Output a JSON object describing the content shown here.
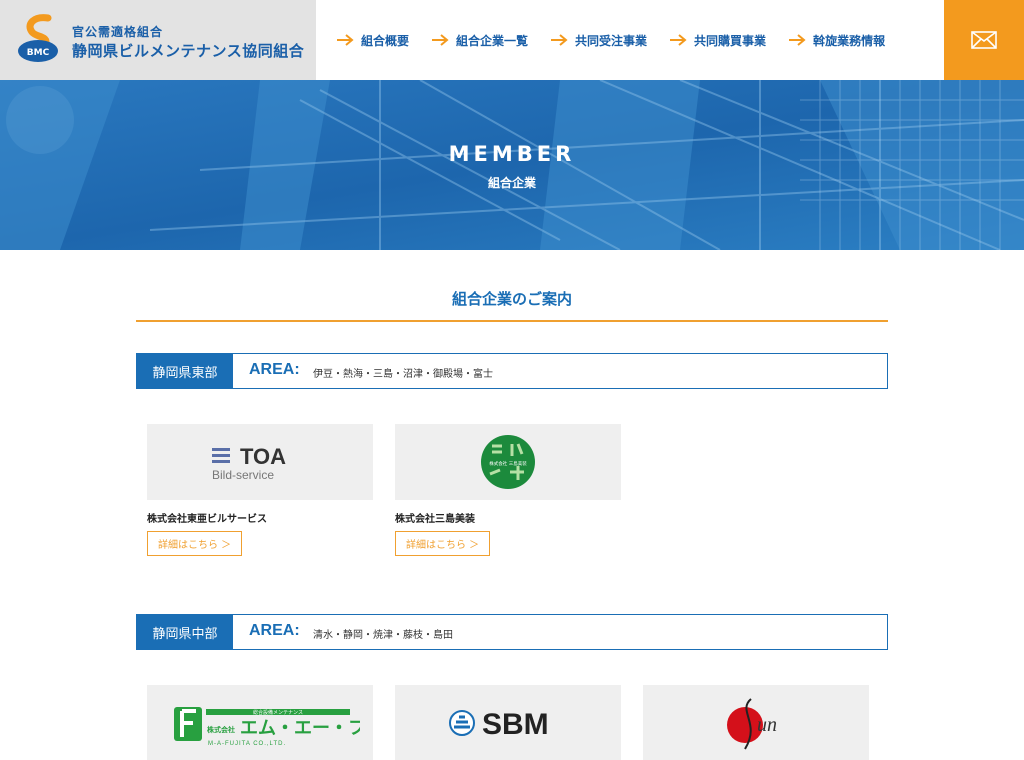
{
  "header": {
    "logo_sub": "官公需適格組合",
    "logo_main": "静岡県ビルメンテナンス協同組合",
    "logo_mark_text": "BMC",
    "nav": [
      {
        "label": "組合概要"
      },
      {
        "label": "組合企業一覧"
      },
      {
        "label": "共同受注事業"
      },
      {
        "label": "共同購買事業"
      },
      {
        "label": "斡旋業務情報"
      }
    ],
    "mail_icon": "envelope-icon"
  },
  "hero": {
    "title": "MEMBER",
    "subtitle": "組合企業"
  },
  "section": {
    "title": "組合企業のご案内"
  },
  "areas": [
    {
      "name": "静岡県東部",
      "label": "AREA:",
      "cities": "伊豆・熱海・三島・沼津・御殿場・富士",
      "companies": [
        {
          "name": "株式会社東亜ビルサービス",
          "button": "詳細はこちら ＞",
          "logo_main": "TOA",
          "logo_sub": "Bild-service"
        },
        {
          "name": "株式会社三島美装",
          "button": "詳細はこちら ＞",
          "logo_main": "株式会社 三島美装"
        }
      ]
    },
    {
      "name": "静岡県中部",
      "label": "AREA:",
      "cities": "清水・静岡・焼津・藤枝・島田",
      "companies": [
        {
          "name": "",
          "logo_main": "エム・エー・フジタ",
          "logo_prefix": "株式会社",
          "logo_top": "総合設備メンテナンス",
          "logo_bottom": "M-A-FUJITA CO.,LTD."
        },
        {
          "name": "",
          "logo_main": "SBM"
        },
        {
          "name": "",
          "logo_main": "un"
        }
      ]
    }
  ],
  "colors": {
    "brand_blue": "#1a6eb5",
    "accent_orange": "#f39a1e"
  }
}
